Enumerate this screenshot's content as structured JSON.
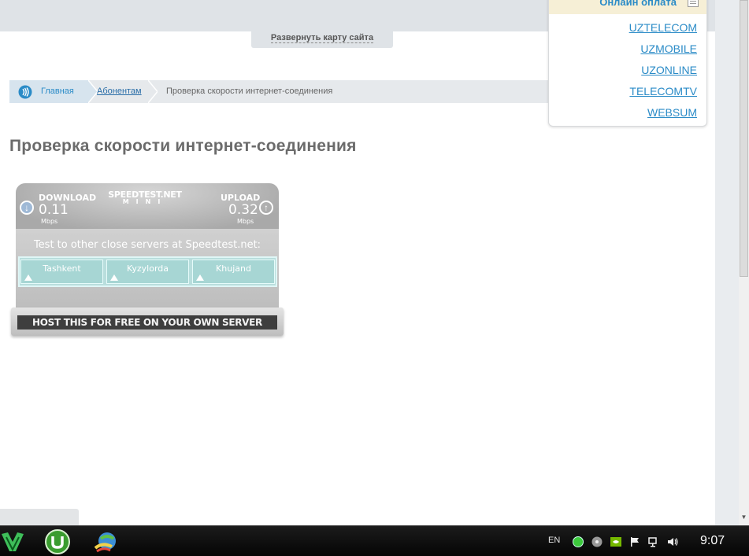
{
  "header": {
    "sitemap_link": "Развернуть карту сайта"
  },
  "breadcrumb": {
    "home": "Главная",
    "abonentam": "Абонентам",
    "current": "Проверка скорости интернет-соединения"
  },
  "page": {
    "heading": "Проверка скорости интернет-соединения"
  },
  "online_payment": {
    "title": "Онлайн оплата",
    "links": [
      "UZTELECOM",
      "UZMOBILE",
      "UZONLINE",
      "TELECOMTV",
      "WEBSUM"
    ]
  },
  "speedtest": {
    "logo_main": "SPEEDTEST.NET",
    "logo_sub": "MINI",
    "download_label": "DOWNLOAD",
    "download_value": "0.11",
    "download_unit": "Mbps",
    "upload_label": "UPLOAD",
    "upload_value": "0.32",
    "upload_unit": "Mbps",
    "servers_title": "Test to other close servers at Speedtest.net:",
    "servers": [
      "Tashkent",
      "Kyzylorda",
      "Khujand"
    ],
    "host_button": "HOST THIS FOR FREE ON YOUR OWN SERVER"
  },
  "taskbar": {
    "language": "EN",
    "clock": "9:07",
    "apps": [
      "bitdefender-icon",
      "utorrent-icon",
      "internet-download-manager-icon"
    ]
  },
  "colors": {
    "link_blue": "#2a8bc7",
    "heading_gray": "#6b6b6b",
    "payment_header_bg": "#f6efd6"
  }
}
